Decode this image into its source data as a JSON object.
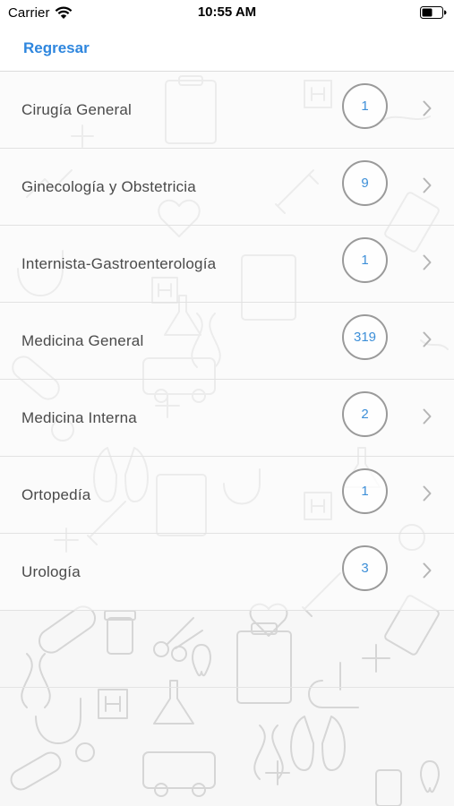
{
  "status_bar": {
    "carrier": "Carrier",
    "time": "10:55 AM",
    "wifi_icon": "wifi-icon",
    "battery_icon": "battery-icon"
  },
  "nav": {
    "back_label": "Regresar"
  },
  "colors": {
    "accent": "#2e86de",
    "badge_text": "#3d8fd8",
    "badge_border": "#9a9a9a",
    "text": "#4a4a4a"
  },
  "specialties": [
    {
      "name": "Cirugía General",
      "count": "1"
    },
    {
      "name": "Ginecología y Obstetricia",
      "count": "9"
    },
    {
      "name": "Internista-Gastroenterología",
      "count": "1"
    },
    {
      "name": "Medicina General",
      "count": "319"
    },
    {
      "name": "Medicina Interna",
      "count": "2"
    },
    {
      "name": "Ortopedía",
      "count": "1"
    },
    {
      "name": "Urología",
      "count": "3"
    }
  ]
}
